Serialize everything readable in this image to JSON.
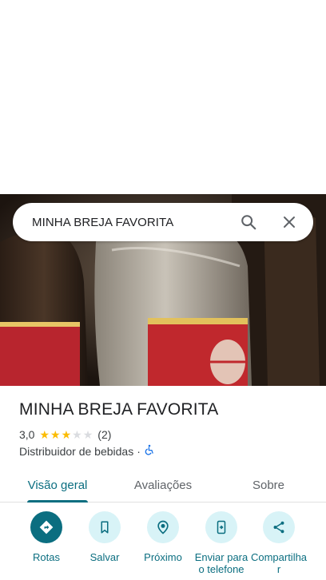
{
  "search": {
    "query": "MINHA BREJA FAVORITA",
    "search_icon": "search-icon",
    "close_icon": "close-icon"
  },
  "place": {
    "name": "MINHA BREJA FAVORITA",
    "rating": "3,0",
    "stars_filled": 3,
    "stars_total": 5,
    "review_count": "(2)",
    "category": "Distribuidor de bebidas",
    "separator": "·",
    "accessibility_icon": "wheelchair-icon"
  },
  "tabs": [
    {
      "label": "Visão geral",
      "active": true
    },
    {
      "label": "Avaliações",
      "active": false
    },
    {
      "label": "Sobre",
      "active": false
    }
  ],
  "actions": [
    {
      "label": "Rotas",
      "icon": "directions-icon"
    },
    {
      "label": "Salvar",
      "icon": "bookmark-icon"
    },
    {
      "label": "Próximo",
      "icon": "nearby-icon"
    },
    {
      "label": "Enviar para o telefone",
      "icon": "send-to-phone-icon"
    },
    {
      "label": "Compartilhar",
      "icon": "share-icon"
    }
  ],
  "colors": {
    "accent": "#0b6e80",
    "star": "#fbbc04",
    "star_empty": "#dadce0",
    "action_bg": "#d8f3f7"
  }
}
